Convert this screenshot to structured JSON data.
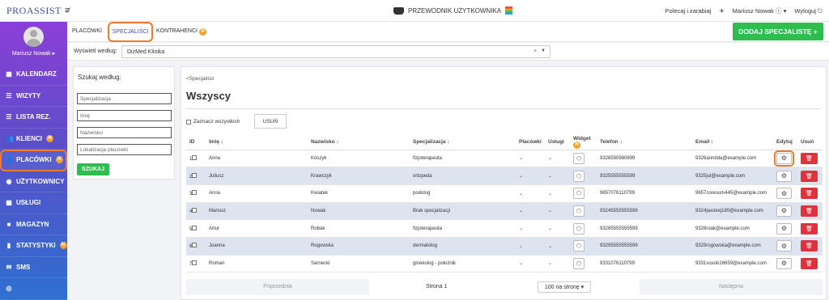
{
  "app": {
    "logo": "PROASSIST",
    "guide": "PRZEWODNIK UŻYTKOWNIKA",
    "recommend": "Polecaj i zarabiaj",
    "user": "Mariusz Nowak",
    "logout": "Wyloguj"
  },
  "sidebar": {
    "user_name": "Mariusz Nowak",
    "items": [
      {
        "label": "KALENDARZ",
        "icon": "calendar-icon"
      },
      {
        "label": "WIZYTY",
        "icon": "list-icon"
      },
      {
        "label": "LISTA REZ.",
        "icon": "list-icon"
      },
      {
        "label": "KLIENCI",
        "icon": "users-icon",
        "badge": "N"
      },
      {
        "label": "PLACÓWKI",
        "icon": "user-icon",
        "badge": "N"
      },
      {
        "label": "UŻYTKOWNICY",
        "icon": "user-circle-icon"
      },
      {
        "label": "USŁUGI",
        "icon": "grid-icon"
      },
      {
        "label": "MAGAZYN",
        "icon": "box-icon"
      },
      {
        "label": "STATYSTYKI",
        "icon": "chart-icon",
        "badge": "N"
      },
      {
        "label": "SMS",
        "icon": "sms-icon"
      }
    ]
  },
  "tabs": {
    "items": [
      "PLACÓWKI",
      "SPECJALIŚCI",
      "KONTRAHENCI"
    ],
    "badge": "N"
  },
  "add_button": "DODAJ SPECJALISTĘ +",
  "filter": {
    "label": "Wyświetl według:",
    "value": "DizMed Klinika"
  },
  "search": {
    "title": "Szukaj według:",
    "fields": [
      "Specjalizacja",
      "Imię",
      "Nazwisko",
      "Lokalizacja placówki"
    ],
    "button": "SZUKAJ"
  },
  "main": {
    "breadcrumb": "<Specjaliści",
    "title": "Wszyscy",
    "select_all": "Zaznacz wszystkich",
    "delete": "USUŃ"
  },
  "table": {
    "headers": [
      "ID",
      "Imię",
      "Nazwisko",
      "Specjalizacja",
      "Placówki",
      "Usługi",
      "Widget",
      "Telefon",
      "Email",
      "Edytuj",
      "Usuń"
    ],
    "widget_badge": "N",
    "rows": [
      {
        "id": "1",
        "first": "Anna",
        "last": "Koszyk",
        "spec": "fizjoterapeuta",
        "phone": "9326590980899",
        "email": "9326anndda@example.com"
      },
      {
        "id": "2",
        "first": "Juliusz",
        "last": "Krawczyk",
        "spec": "ortopeda",
        "phone": "9325555555599",
        "email": "9325jul@example.com"
      },
      {
        "id": "3",
        "first": "Anna",
        "last": "Kwiatek",
        "spec": "podolog",
        "phone": "9657076110799",
        "email": "9657coresom445@example.com"
      },
      {
        "id": "4",
        "first": "Mariusz",
        "last": "Nowak",
        "spec": "Brak specjalizacji",
        "phone": "93245555555599",
        "email": "9324jaxokej180@example.com"
      },
      {
        "id": "5",
        "first": "Artur",
        "last": "Robak",
        "spec": "fizjoterapeuta",
        "phone": "93285555555599",
        "email": "9328roak@example.com"
      },
      {
        "id": "6",
        "first": "Joanna",
        "last": "Rogowska",
        "spec": "dermatolog",
        "phone": "93295555555599",
        "email": "9329rogowska@example.com"
      },
      {
        "id": "7",
        "first": "Roman",
        "last": "Sarnecki",
        "spec": "ginekolog - położnik",
        "phone": "9331076110799",
        "email": "9331sosob16659@example.com"
      }
    ]
  },
  "pager": {
    "prev": "Poprzednia",
    "page": "Strona 1",
    "per_page": "100 na stronę",
    "next": "Następna"
  },
  "colors": {
    "accent": "#2fbd4f",
    "highlight": "#f07a2a",
    "delete": "#e0323c"
  }
}
